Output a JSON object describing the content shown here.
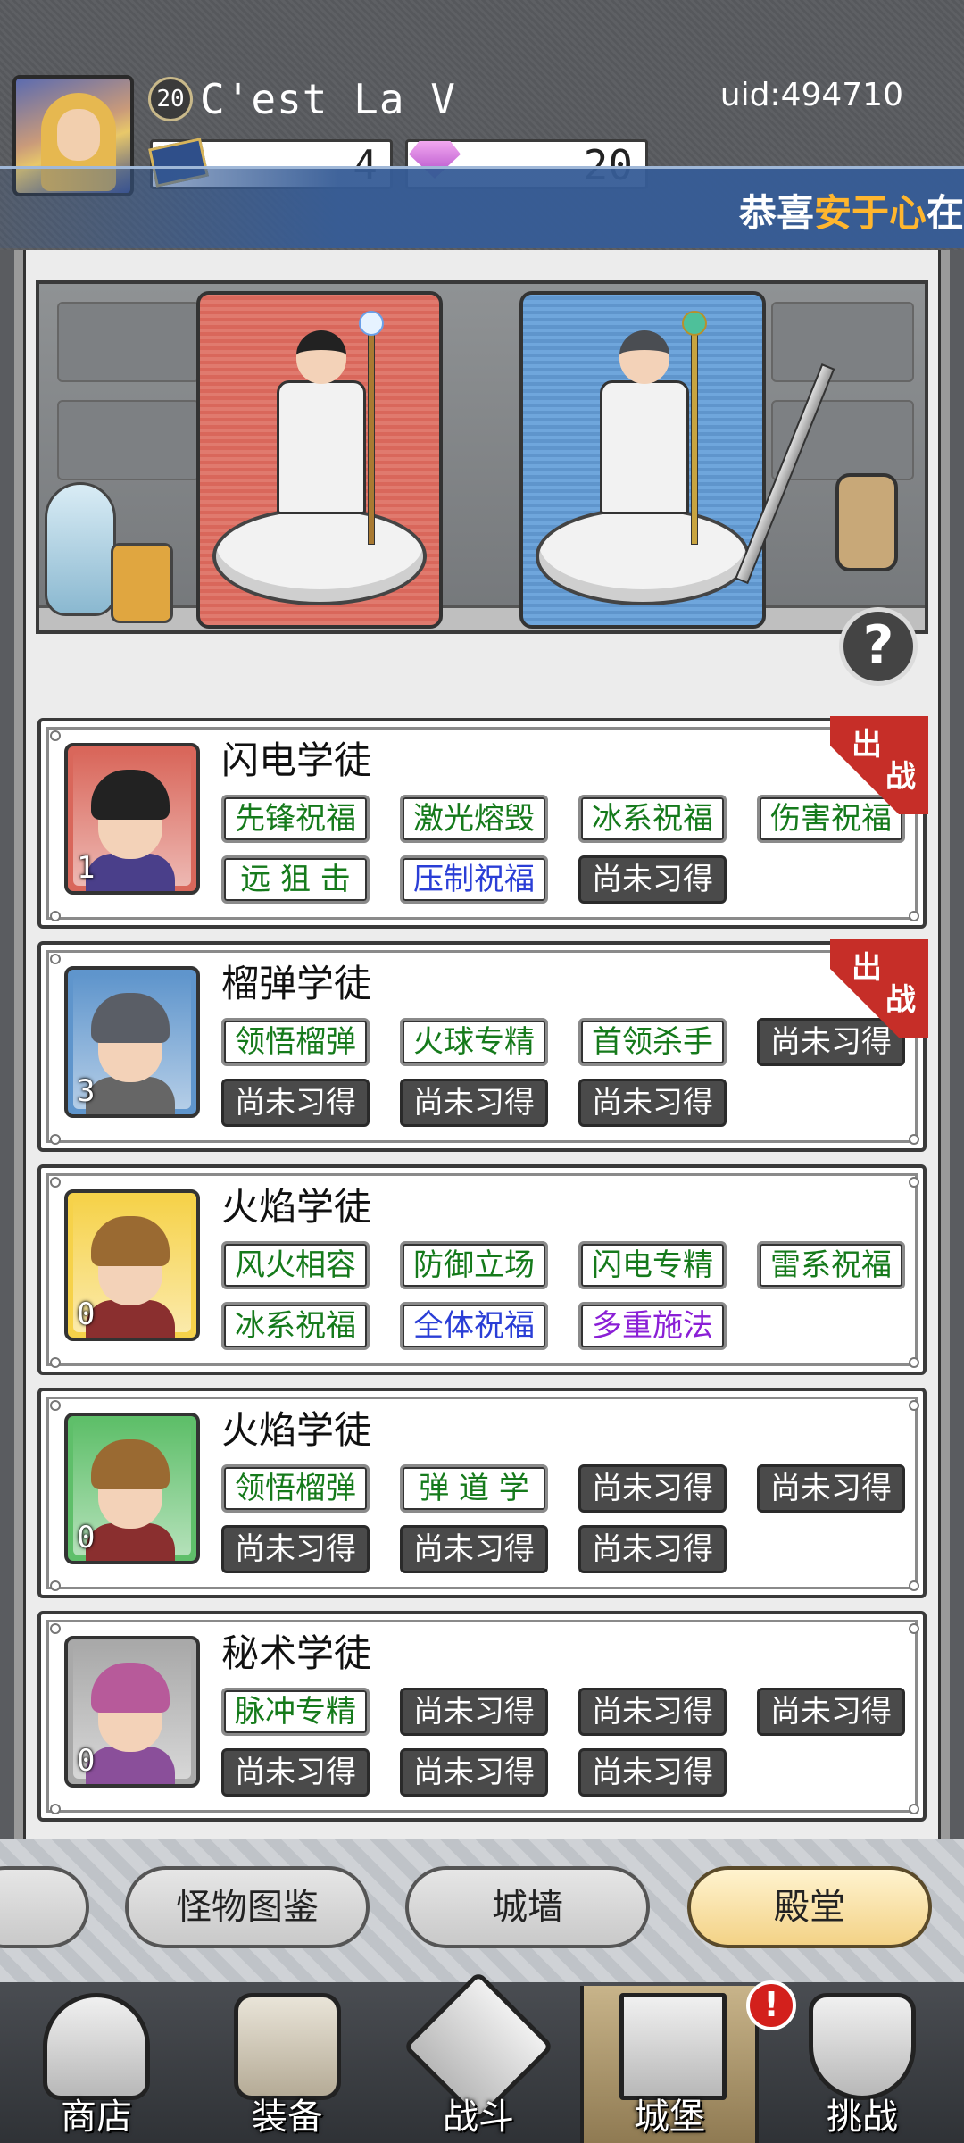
{
  "player": {
    "level": "20",
    "name": "C'est La V",
    "uid": "uid:494710",
    "resource_1": "4",
    "resource_2": "20"
  },
  "banner": {
    "prefix": "恭喜",
    "highlight": "安于心",
    "suffix": "在"
  },
  "help_label": "?",
  "deploy_label": {
    "top": "出",
    "bottom": "战"
  },
  "roster": [
    {
      "title": "闪电学徒",
      "count": "1",
      "deployed": true,
      "skills": [
        {
          "label": "先锋祝福",
          "state": "on",
          "color": "green"
        },
        {
          "label": "激光熔毁",
          "state": "on",
          "color": "green"
        },
        {
          "label": "冰系祝福",
          "state": "on",
          "color": "green"
        },
        {
          "label": "伤害祝福",
          "state": "on",
          "color": "green"
        },
        {
          "label": "远 狙 击",
          "state": "on",
          "color": "green"
        },
        {
          "label": "压制祝福",
          "state": "on",
          "color": "blue"
        },
        {
          "label": "尚未习得",
          "state": "off",
          "color": "white"
        }
      ]
    },
    {
      "title": "榴弹学徒",
      "count": "3",
      "deployed": true,
      "skills": [
        {
          "label": "领悟榴弹",
          "state": "on",
          "color": "green"
        },
        {
          "label": "火球专精",
          "state": "on",
          "color": "green"
        },
        {
          "label": "首领杀手",
          "state": "on",
          "color": "green"
        },
        {
          "label": "尚未习得",
          "state": "off",
          "color": "white"
        },
        {
          "label": "尚未习得",
          "state": "off",
          "color": "white"
        },
        {
          "label": "尚未习得",
          "state": "off",
          "color": "white"
        },
        {
          "label": "尚未习得",
          "state": "off",
          "color": "white"
        }
      ]
    },
    {
      "title": "火焰学徒",
      "count": "0",
      "deployed": false,
      "skills": [
        {
          "label": "风火相容",
          "state": "on",
          "color": "green"
        },
        {
          "label": "防御立场",
          "state": "on",
          "color": "green"
        },
        {
          "label": "闪电专精",
          "state": "on",
          "color": "green"
        },
        {
          "label": "雷系祝福",
          "state": "on",
          "color": "green"
        },
        {
          "label": "冰系祝福",
          "state": "on",
          "color": "green"
        },
        {
          "label": "全体祝福",
          "state": "on",
          "color": "blue"
        },
        {
          "label": "多重施法",
          "state": "on",
          "color": "purple"
        }
      ]
    },
    {
      "title": "火焰学徒",
      "count": "0",
      "deployed": false,
      "skills": [
        {
          "label": "领悟榴弹",
          "state": "on",
          "color": "green"
        },
        {
          "label": "弹 道 学",
          "state": "on",
          "color": "green"
        },
        {
          "label": "尚未习得",
          "state": "off",
          "color": "white"
        },
        {
          "label": "尚未习得",
          "state": "off",
          "color": "white"
        },
        {
          "label": "尚未习得",
          "state": "off",
          "color": "white"
        },
        {
          "label": "尚未习得",
          "state": "off",
          "color": "white"
        },
        {
          "label": "尚未习得",
          "state": "off",
          "color": "white"
        }
      ]
    },
    {
      "title": "秘术学徒",
      "count": "0",
      "deployed": false,
      "skills": [
        {
          "label": "脉冲专精",
          "state": "on",
          "color": "green"
        },
        {
          "label": "尚未习得",
          "state": "off",
          "color": "white"
        },
        {
          "label": "尚未习得",
          "state": "off",
          "color": "white"
        },
        {
          "label": "尚未习得",
          "state": "off",
          "color": "white"
        },
        {
          "label": "尚未习得",
          "state": "off",
          "color": "white"
        },
        {
          "label": "尚未习得",
          "state": "off",
          "color": "white"
        },
        {
          "label": "尚未习得",
          "state": "off",
          "color": "white"
        }
      ]
    }
  ],
  "tabs": {
    "monster_codex": "怪物图鉴",
    "city_wall": "城墙",
    "hall": "殿堂",
    "active": "殿堂"
  },
  "nav": {
    "shop": "商店",
    "equipment": "装备",
    "battle": "战斗",
    "castle": "城堡",
    "challenge": "挑战",
    "alert": "!",
    "active": "城堡"
  },
  "colors": {
    "green": "#157a1b",
    "blue": "#2a3ed6",
    "purple": "#8a1fd6",
    "deploy_red": "#c62e28",
    "banner_highlight": "#ffb62e",
    "frame_red": "#d9675b",
    "frame_blue": "#5f95cc",
    "frame_yellow": "#f6d24a",
    "frame_green": "#5fbf6a",
    "frame_gray": "#a9a9a9"
  }
}
